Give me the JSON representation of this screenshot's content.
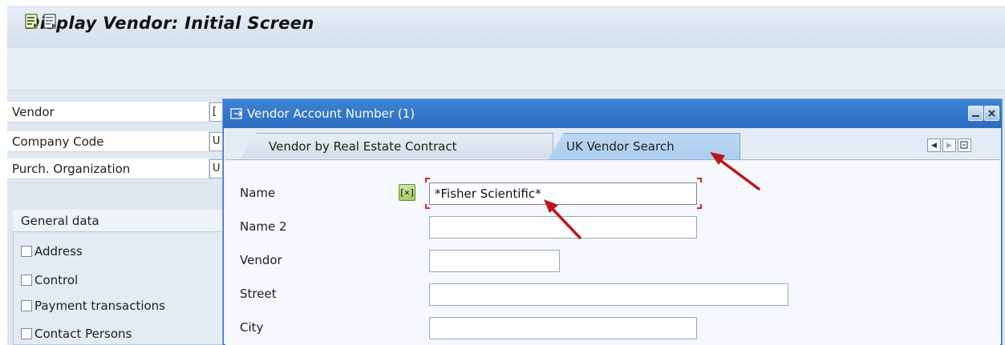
{
  "screen": {
    "title": "Display Vendor: Initial Screen",
    "toolbar": [
      {
        "icon": "entry-view-icon"
      },
      {
        "icon": "document-view-icon"
      }
    ],
    "fields": [
      {
        "label": "Vendor",
        "value": "["
      },
      {
        "label": "Company Code",
        "value": "U"
      },
      {
        "label": "Purch. Organization",
        "value": "U"
      }
    ],
    "general_data": {
      "title": "General data",
      "options": [
        {
          "label": "Address",
          "checked": false
        },
        {
          "label": "Control",
          "checked": false
        },
        {
          "label": "Payment transactions",
          "checked": false
        },
        {
          "label": "Contact Persons",
          "checked": false
        }
      ]
    }
  },
  "dialog": {
    "title": "Vendor Account Number (1)",
    "tabs": [
      {
        "label": "Vendor by Real Estate Contract",
        "active": false
      },
      {
        "label": "UK Vendor Search",
        "active": true
      }
    ],
    "multiple_selection_symbol": "[×]",
    "fields": [
      {
        "label": "Name",
        "value": "*Fisher Scientific*"
      },
      {
        "label": "Name 2",
        "value": ""
      },
      {
        "label": "Vendor",
        "value": ""
      },
      {
        "label": "Street",
        "value": ""
      },
      {
        "label": "City",
        "value": ""
      }
    ]
  },
  "colors": {
    "dialog_titlebar": "#2d6cc0",
    "active_tab": "#aacdf0",
    "annotation_arrow": "#c0161b",
    "required_bracket": "#d9221c"
  }
}
